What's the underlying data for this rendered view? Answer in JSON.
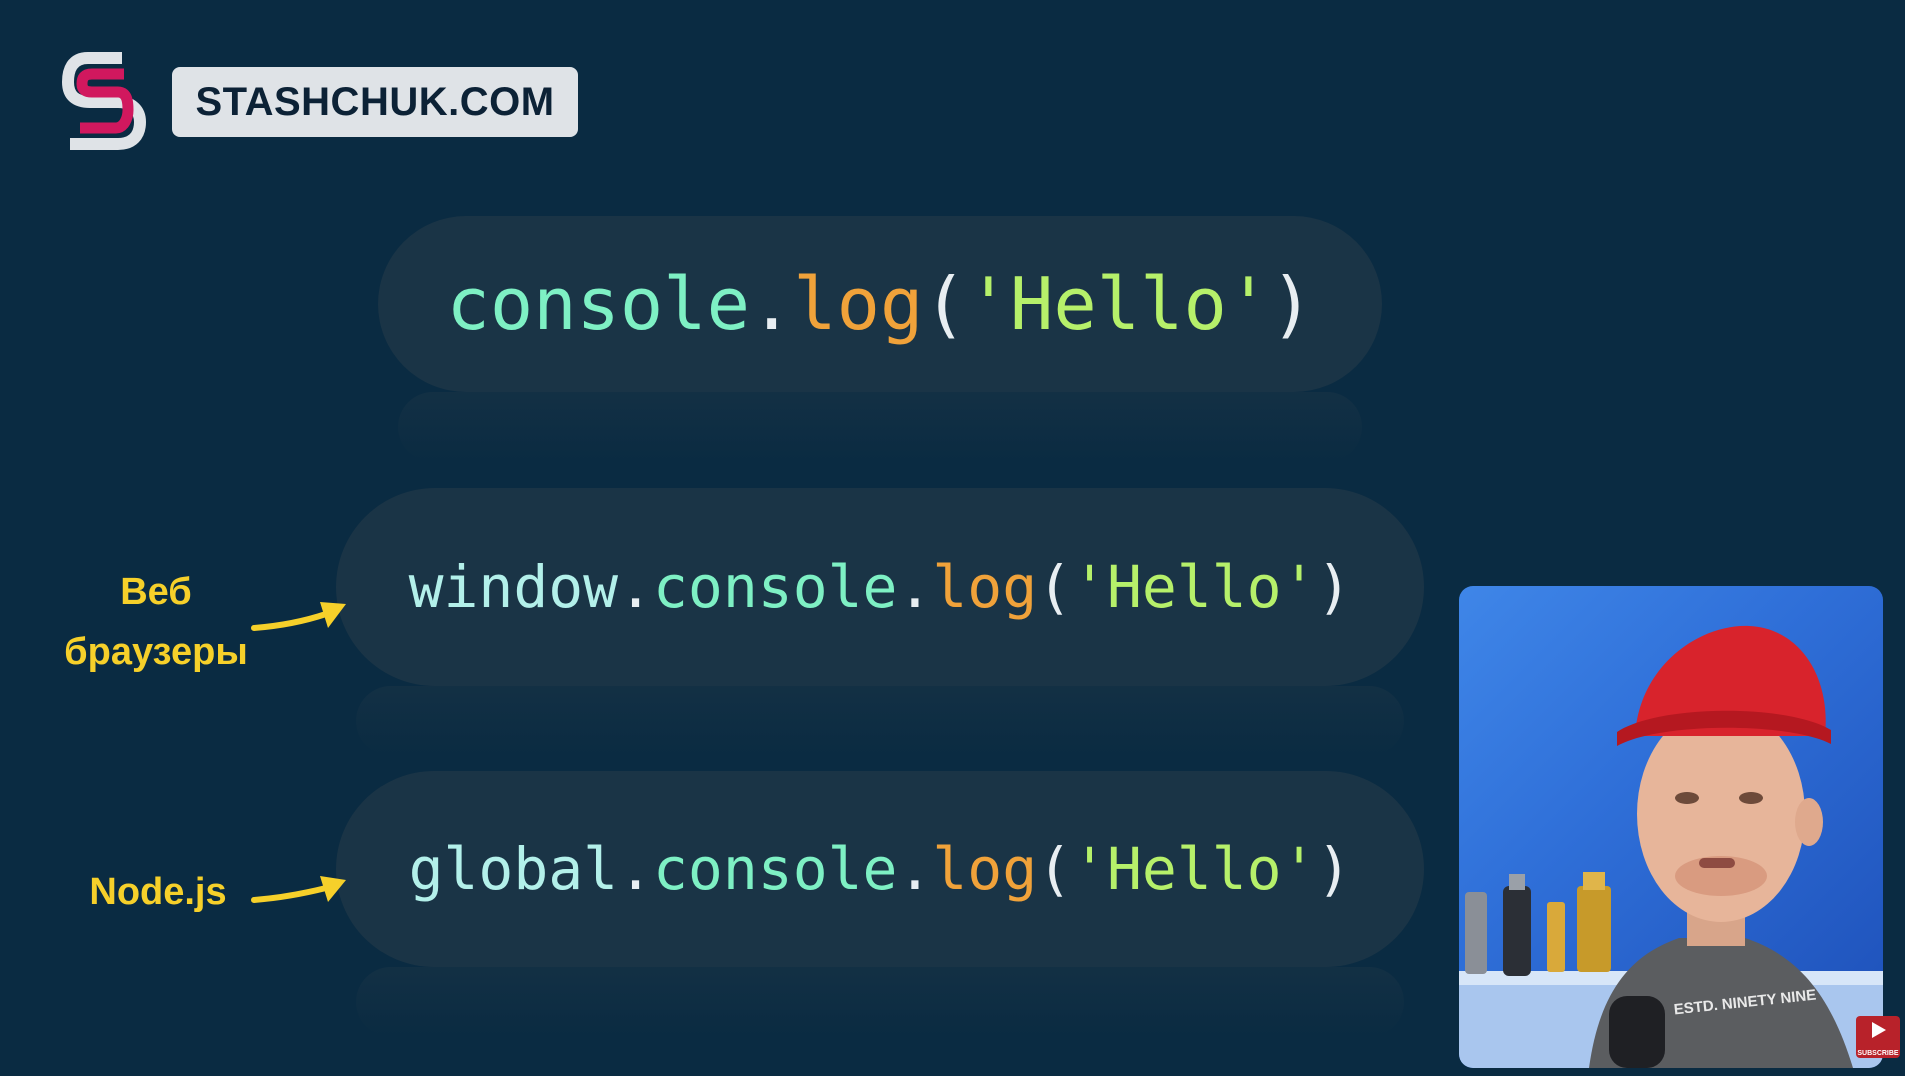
{
  "brand": {
    "site_name": "STASHCHUK.COM",
    "logo_letter": "S",
    "logo_colors": {
      "primary": "#d1185e",
      "secondary": "#dfe3e7"
    }
  },
  "code_lines": [
    {
      "tokens": {
        "con": "console",
        "dot": ".",
        "fn": "log",
        "open": "(",
        "str": "'Hello'",
        "close": ")"
      }
    },
    {
      "tokens": {
        "obj": "window",
        "dot1": ".",
        "con": "console",
        "dot2": ".",
        "fn": "log",
        "open": "(",
        "str": "'Hello'",
        "close": ")"
      }
    },
    {
      "tokens": {
        "obj": "global",
        "dot1": ".",
        "con": "console",
        "dot2": ".",
        "fn": "log",
        "open": "(",
        "str": "'Hello'",
        "close": ")"
      }
    }
  ],
  "annotations": {
    "browsers_line1": "Веб",
    "browsers_line2": "браузеры",
    "node": "Node.js"
  },
  "webcam": {
    "shirt_text": "ESTD. NINETY NINE",
    "subscribe_label": "SUBSCRIBE"
  },
  "colors": {
    "background": "#0a2b42",
    "pill": "#1a3446",
    "object_token": "#b3f0ea",
    "console_token": "#7ef0c4",
    "function_token": "#f0a23a",
    "string_token": "#b6f06a",
    "annotation": "#f6d02a"
  }
}
